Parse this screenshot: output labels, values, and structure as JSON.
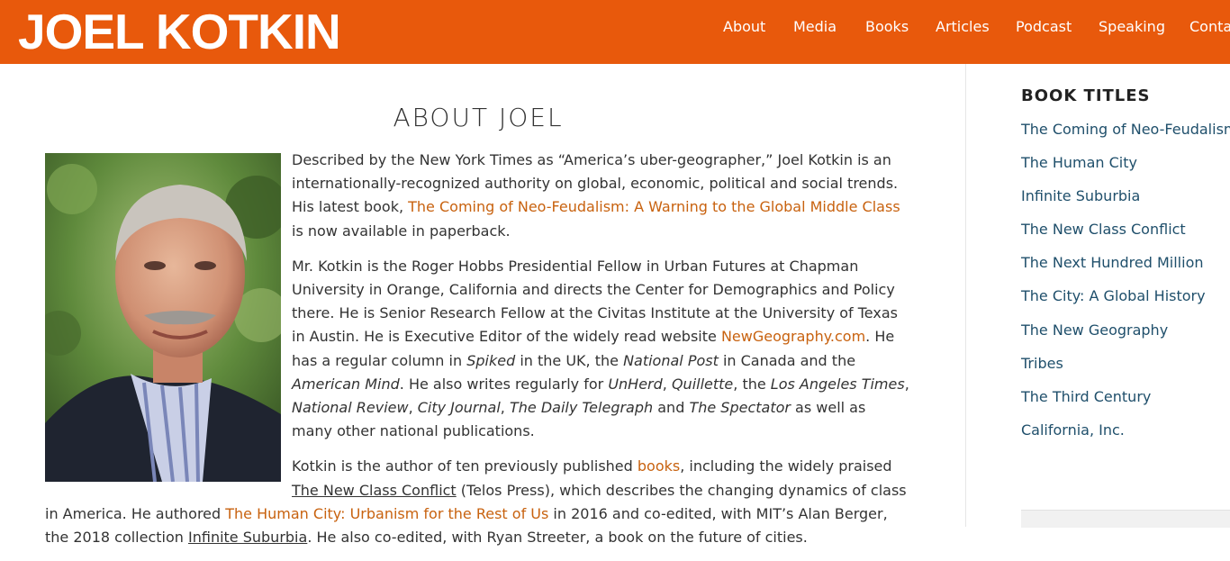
{
  "header": {
    "logo": "JOEL KOTKIN",
    "nav": [
      "About",
      "Media",
      "Books",
      "Articles",
      "Podcast",
      "Speaking",
      "Conta"
    ]
  },
  "main": {
    "title": "ABOUT JOEL",
    "p1": {
      "a": "Described by the New York Times as “America’s uber-geographer,” Joel Kotkin is an internationally-recognized authority on global, economic, political and social trends. His latest book, ",
      "link": "The Coming of Neo-Feudalism: A Warning to the Global Middle Class",
      "b": " is now available in paperback."
    },
    "p2": {
      "a": "Mr. Kotkin is the Roger Hobbs Presidential Fellow in Urban Futures at Chapman University in Orange, California and directs the Center for Demographics and Policy there. He is Senior Research Fellow at the Civitas Institute at the University of Texas in Austin. He is Executive Editor of the widely read website ",
      "link": "NewGeography.com",
      "b": ". He has a regular column in ",
      "i1": "Spiked",
      "c": " in the UK, the ",
      "i2": "National Post",
      "d": " in Canada and the ",
      "i3": "American Mind",
      "e": ". He also writes regularly for ",
      "i4": "UnHerd",
      "f": ", ",
      "i5": "Quillette",
      "g": ", the ",
      "i6": "Los Angeles Times",
      "h": ", ",
      "i7": "National Review",
      "j": ", ",
      "i8": "City Journal",
      "k": ", ",
      "i9": "The Daily Telegraph",
      "l": " and ",
      "i10": "The Spectator",
      "m": " as well as many other national publications."
    },
    "p3": {
      "a": "Kotkin is the author of ten previously published ",
      "link1": "books",
      "b": ", including the widely praised ",
      "u1": "The New Class Conflict",
      "c": " (Telos Press), which describes the changing dynamics of class in America. He authored ",
      "link2": "The Human City: Urbanism for the Rest of Us",
      "d": " in 2016 and co-edited, with MIT’s Alan Berger, the 2018 collection ",
      "u2": "Infinite Suburbia",
      "e": ". He also co-edited, with Ryan Streeter, a book on the future of cities."
    }
  },
  "sidebar": {
    "title": "BOOK TITLES",
    "items": [
      "The Coming of Neo-Feudalism",
      "The Human City",
      "Infinite Suburbia",
      "The New Class Conflict",
      "The Next Hundred Million",
      "The City: A Global History",
      "The New Geography",
      "Tribes",
      "The Third Century",
      "California, Inc."
    ]
  },
  "colors": {
    "header_bg": "#e8590c",
    "link": "#c8620f",
    "sidebar_link": "#1f4f6b"
  }
}
